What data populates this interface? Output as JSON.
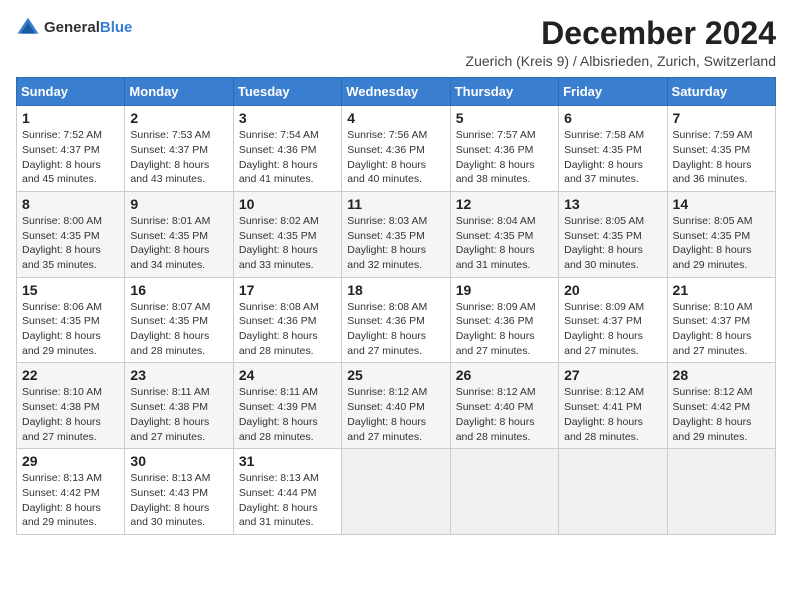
{
  "logo": {
    "general": "General",
    "blue": "Blue"
  },
  "title": "December 2024",
  "subtitle": "Zuerich (Kreis 9) / Albisrieden, Zurich, Switzerland",
  "headers": [
    "Sunday",
    "Monday",
    "Tuesday",
    "Wednesday",
    "Thursday",
    "Friday",
    "Saturday"
  ],
  "weeks": [
    [
      {
        "day": "1",
        "rise": "Sunrise: 7:52 AM",
        "set": "Sunset: 4:37 PM",
        "daylight": "Daylight: 8 hours and 45 minutes."
      },
      {
        "day": "2",
        "rise": "Sunrise: 7:53 AM",
        "set": "Sunset: 4:37 PM",
        "daylight": "Daylight: 8 hours and 43 minutes."
      },
      {
        "day": "3",
        "rise": "Sunrise: 7:54 AM",
        "set": "Sunset: 4:36 PM",
        "daylight": "Daylight: 8 hours and 41 minutes."
      },
      {
        "day": "4",
        "rise": "Sunrise: 7:56 AM",
        "set": "Sunset: 4:36 PM",
        "daylight": "Daylight: 8 hours and 40 minutes."
      },
      {
        "day": "5",
        "rise": "Sunrise: 7:57 AM",
        "set": "Sunset: 4:36 PM",
        "daylight": "Daylight: 8 hours and 38 minutes."
      },
      {
        "day": "6",
        "rise": "Sunrise: 7:58 AM",
        "set": "Sunset: 4:35 PM",
        "daylight": "Daylight: 8 hours and 37 minutes."
      },
      {
        "day": "7",
        "rise": "Sunrise: 7:59 AM",
        "set": "Sunset: 4:35 PM",
        "daylight": "Daylight: 8 hours and 36 minutes."
      }
    ],
    [
      {
        "day": "8",
        "rise": "Sunrise: 8:00 AM",
        "set": "Sunset: 4:35 PM",
        "daylight": "Daylight: 8 hours and 35 minutes."
      },
      {
        "day": "9",
        "rise": "Sunrise: 8:01 AM",
        "set": "Sunset: 4:35 PM",
        "daylight": "Daylight: 8 hours and 34 minutes."
      },
      {
        "day": "10",
        "rise": "Sunrise: 8:02 AM",
        "set": "Sunset: 4:35 PM",
        "daylight": "Daylight: 8 hours and 33 minutes."
      },
      {
        "day": "11",
        "rise": "Sunrise: 8:03 AM",
        "set": "Sunset: 4:35 PM",
        "daylight": "Daylight: 8 hours and 32 minutes."
      },
      {
        "day": "12",
        "rise": "Sunrise: 8:04 AM",
        "set": "Sunset: 4:35 PM",
        "daylight": "Daylight: 8 hours and 31 minutes."
      },
      {
        "day": "13",
        "rise": "Sunrise: 8:05 AM",
        "set": "Sunset: 4:35 PM",
        "daylight": "Daylight: 8 hours and 30 minutes."
      },
      {
        "day": "14",
        "rise": "Sunrise: 8:05 AM",
        "set": "Sunset: 4:35 PM",
        "daylight": "Daylight: 8 hours and 29 minutes."
      }
    ],
    [
      {
        "day": "15",
        "rise": "Sunrise: 8:06 AM",
        "set": "Sunset: 4:35 PM",
        "daylight": "Daylight: 8 hours and 29 minutes."
      },
      {
        "day": "16",
        "rise": "Sunrise: 8:07 AM",
        "set": "Sunset: 4:35 PM",
        "daylight": "Daylight: 8 hours and 28 minutes."
      },
      {
        "day": "17",
        "rise": "Sunrise: 8:08 AM",
        "set": "Sunset: 4:36 PM",
        "daylight": "Daylight: 8 hours and 28 minutes."
      },
      {
        "day": "18",
        "rise": "Sunrise: 8:08 AM",
        "set": "Sunset: 4:36 PM",
        "daylight": "Daylight: 8 hours and 27 minutes."
      },
      {
        "day": "19",
        "rise": "Sunrise: 8:09 AM",
        "set": "Sunset: 4:36 PM",
        "daylight": "Daylight: 8 hours and 27 minutes."
      },
      {
        "day": "20",
        "rise": "Sunrise: 8:09 AM",
        "set": "Sunset: 4:37 PM",
        "daylight": "Daylight: 8 hours and 27 minutes."
      },
      {
        "day": "21",
        "rise": "Sunrise: 8:10 AM",
        "set": "Sunset: 4:37 PM",
        "daylight": "Daylight: 8 hours and 27 minutes."
      }
    ],
    [
      {
        "day": "22",
        "rise": "Sunrise: 8:10 AM",
        "set": "Sunset: 4:38 PM",
        "daylight": "Daylight: 8 hours and 27 minutes."
      },
      {
        "day": "23",
        "rise": "Sunrise: 8:11 AM",
        "set": "Sunset: 4:38 PM",
        "daylight": "Daylight: 8 hours and 27 minutes."
      },
      {
        "day": "24",
        "rise": "Sunrise: 8:11 AM",
        "set": "Sunset: 4:39 PM",
        "daylight": "Daylight: 8 hours and 28 minutes."
      },
      {
        "day": "25",
        "rise": "Sunrise: 8:12 AM",
        "set": "Sunset: 4:40 PM",
        "daylight": "Daylight: 8 hours and 27 minutes."
      },
      {
        "day": "26",
        "rise": "Sunrise: 8:12 AM",
        "set": "Sunset: 4:40 PM",
        "daylight": "Daylight: 8 hours and 28 minutes."
      },
      {
        "day": "27",
        "rise": "Sunrise: 8:12 AM",
        "set": "Sunset: 4:41 PM",
        "daylight": "Daylight: 8 hours and 28 minutes."
      },
      {
        "day": "28",
        "rise": "Sunrise: 8:12 AM",
        "set": "Sunset: 4:42 PM",
        "daylight": "Daylight: 8 hours and 29 minutes."
      }
    ],
    [
      {
        "day": "29",
        "rise": "Sunrise: 8:13 AM",
        "set": "Sunset: 4:42 PM",
        "daylight": "Daylight: 8 hours and 29 minutes."
      },
      {
        "day": "30",
        "rise": "Sunrise: 8:13 AM",
        "set": "Sunset: 4:43 PM",
        "daylight": "Daylight: 8 hours and 30 minutes."
      },
      {
        "day": "31",
        "rise": "Sunrise: 8:13 AM",
        "set": "Sunset: 4:44 PM",
        "daylight": "Daylight: 8 hours and 31 minutes."
      },
      null,
      null,
      null,
      null
    ]
  ]
}
